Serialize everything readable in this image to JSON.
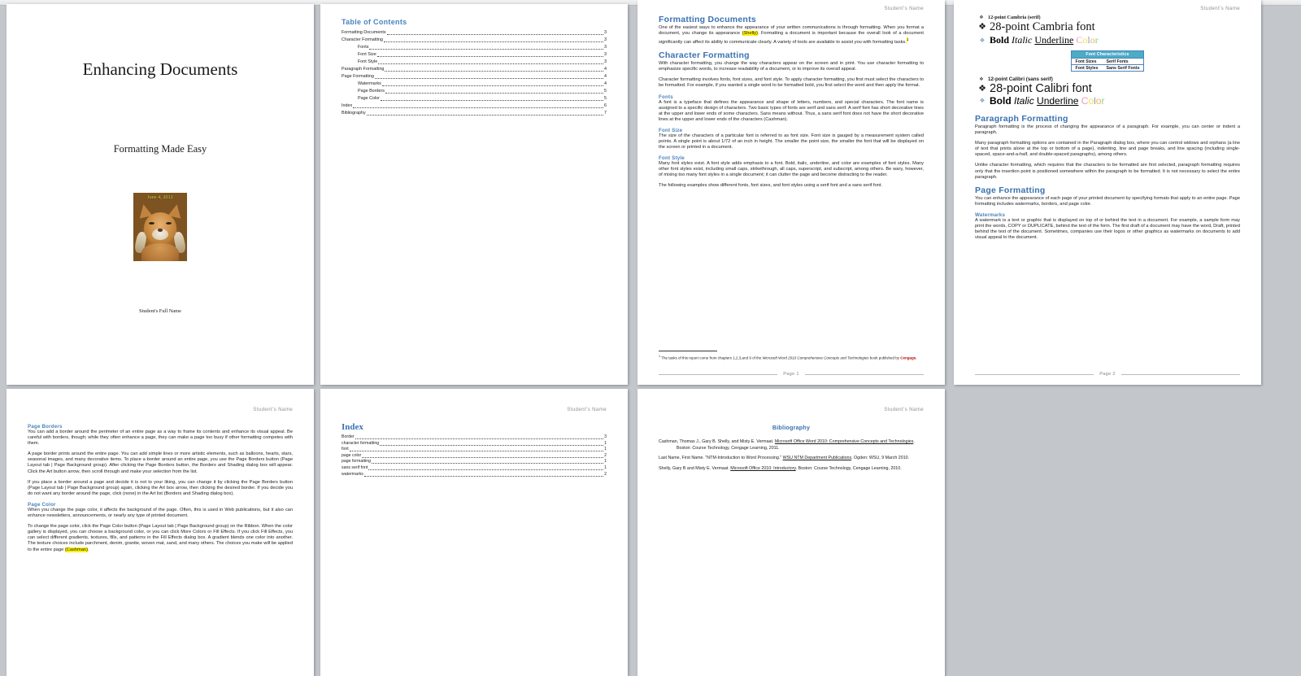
{
  "app": {
    "view": "multi-page-document-view",
    "background_color": "#c3c7cc",
    "header_name": "Student's Name"
  },
  "pages": [
    {
      "id": "title-page",
      "title": "Enhancing Documents",
      "subtitle": "Formatting Made Easy",
      "image_caption": "June 4, 2012",
      "image_alt": "lynx-photo",
      "author": "Student's Full Name"
    },
    {
      "id": "table-of-contents",
      "heading": "Table of Contents",
      "entries": [
        {
          "label": "Formatting Documents",
          "page": "3",
          "level": 1
        },
        {
          "label": "Character Formatting",
          "page": "3",
          "level": 1
        },
        {
          "label": "Fonts",
          "page": "3",
          "level": 2
        },
        {
          "label": "Font Size",
          "page": "3",
          "level": 2
        },
        {
          "label": "Font Style",
          "page": "3",
          "level": 2
        },
        {
          "label": "Paragraph Formatting",
          "page": "4",
          "level": 1
        },
        {
          "label": "Page Formatting",
          "page": "4",
          "level": 1
        },
        {
          "label": "Watermarks",
          "page": "4",
          "level": 2
        },
        {
          "label": "Page Borders",
          "page": "5",
          "level": 2
        },
        {
          "label": "Page Color",
          "page": "5",
          "level": 2
        },
        {
          "label": "Index",
          "page": "6",
          "level": 1
        },
        {
          "label": "Bibliography",
          "page": "7",
          "level": 1
        }
      ]
    },
    {
      "id": "page-1-content",
      "header": "Student's Name",
      "footer": "Page 1",
      "h1_formatting_documents": "Formatting Documents",
      "p_formatting_1a": "One of the easiest ways to enhance the appearance of your written communications is through formatting. When you format a document, you change its appearance ",
      "p_formatting_highlight": "(Shelly)",
      "p_formatting_1b": ". Formatting a document is important because the overall look of a document significantly can affect its ability to communicate clearly. A variety of tools are available to assist you with formatting tasks.",
      "h1_character_formatting": "Character Formatting",
      "p_character_1": "With character formatting, you change the way characters appear on the screen and in print. You use character formatting to emphasize specific words, to increase readability of a document, or to improve its overall appeal.",
      "p_character_2": "Character formatting involves fonts, font sizes, and font style. To apply character formatting, you first must select the characters to be formatted. For example, if you wanted a single word to be formatted bold, you first select the word and then apply the format.",
      "h2_fonts": "Fonts",
      "p_fonts": "A font is a typeface that defines the appearance and shape of letters, numbers, and special characters. The font name is assigned to a specific design of characters. Two basic types of fonts are serif and sans serif. A serif font has short decorative lines at the upper and lower ends of some characters. Sans means without. Thus, a sans serif font does not have the short decorative lines at the upper and lower ends of the characters (Cashman).",
      "h2_font_size": "Font Size",
      "p_font_size": "The size of the characters of a particular font is referred to as font size. Font size is gauged by a measurement system called points. A single point is about 1/72 of an inch in height. The smaller the point size, the smaller the font that will be displayed on the screen or printed in a document.",
      "h2_font_style": "Font Style",
      "p_font_style": "Many font styles exist. A font style adds emphasis to a font. Bold, italic, underline, and color are examples of font styles. Many other font styles exist, including small caps, strikethrough, all caps, superscript, and subscript, among others. Be wary, however, of mixing too many font styles in a single document; it can clutter the page and become distracting to the reader.",
      "p_examples": "The following examples show different fonts, font sizes, and font styles using a serif font and a sans serif font.",
      "footnote_marker": "1",
      "footnote_a": "The tasks of this report come from chapters 1,2,3,and 9 of the ",
      "footnote_italic": "Microsoft Word 2010 Comprehensive Concepts and Technologies",
      "footnote_b": " book published by ",
      "footnote_publisher": "Cengage."
    },
    {
      "id": "page-2-content",
      "header": "Student's Name",
      "footer": "Page 2",
      "samples": [
        {
          "label": "12-point Cambria (serif)",
          "style": "small-serif"
        },
        {
          "label": "28-point Cambria font",
          "style": "big-serif"
        },
        {
          "label": "Bold Italic Underline Color",
          "style": "styles-serif"
        },
        {
          "label": "12-point Calibri (sans serif)",
          "style": "small-sans"
        },
        {
          "label": "28-point Calibri font",
          "style": "big-sans"
        },
        {
          "label": "Bold Italic Underline Color",
          "style": "styles-sans"
        }
      ],
      "style_words": {
        "bold": "Bold",
        "italic": "Italic",
        "underline": "Underline",
        "color": "Color"
      },
      "color_letters": [
        "C",
        "o",
        "l",
        "o",
        "r"
      ],
      "font_table": {
        "caption": "Font Characteristics",
        "rows": [
          [
            "Font Sizes",
            "Serif Fonts"
          ],
          [
            "Font Styles",
            "Sans Serif Fonts"
          ]
        ]
      },
      "h1_paragraph_formatting": "Paragraph Formatting",
      "p_paragraph_1": "Paragraph formatting is the process of changing the appearance of a paragraph. For example, you can center or indent a paragraph.",
      "p_paragraph_2": "Many paragraph formatting options are contained in the Paragraph dialog box, where you can control widows and orphans (a line of text that prints alone at the top or bottom of a page), indenting, line and page breaks, and line spacing (including single-spaced, space-and-a-half, and double-spaced paragraphs), among others.",
      "p_paragraph_3": "Unlike character formatting, which requires that the characters to be formatted are first selected, paragraph formatting requires only that the insertion point is positioned somewhere within the paragraph to be formatted. It is not necessary to select the entire paragraph.",
      "h1_page_formatting": "Page Formatting",
      "p_page_formatting": "You can enhance the appearance of each page of your printed document by specifying formats that apply to an entire page. Page formatting includes watermarks, borders, and page color.",
      "h2_watermarks": "Watermarks",
      "p_watermarks": "A watermark is a text or graphic that is displayed on top of or behind the text in a document. For example, a sample form may print the words, COPY or DUPLICATE, behind the text of the form. The first draft of a document may have the word, Draft, printed behind the text of the document. Sometimes, companies use their logos or other graphics as watermarks on documents to add visual appeal to the document."
    },
    {
      "id": "page-3-content",
      "header": "Student's Name",
      "h2_page_borders": "Page Borders",
      "p_borders_1": "You can add a border around the perimeter of an entire page as a way to frame its contents and enhance its visual appeal. Be careful with borders, though; while they often enhance a page, they can make a page too busy if other formatting competes with them.",
      "p_borders_2": "A page border prints around the entire page. You can add simple lines or more artistic elements, such as balloons, hearts, stars, seasonal images, and many decorative items. To place a border around an entire page, you use the Page Borders button (Page Layout tab | Page Background group). After clicking the Page Borders button, the Borders and Shading dialog box will appear. Click the Art button arrow, then scroll through and make your selection from the list.",
      "p_borders_3": "If you place a border around a page and decide it is not to your liking, you can change it by clicking the Page Borders button (Page Layout tab | Page Background group) again, clicking the Art box arrow, then clicking the desired border. If you decide you do not want any border around the page, click (none) in the Art list (Borders and Shading dialog box).",
      "h2_page_color": "Page Color",
      "p_color_1": "When you change the page color, it affects the background of the page. Often, this is used in Web publications, but it also can enhance newsletters, announcements, or nearly any type of printed document.",
      "p_color_2a": "To change the page color, click the Page Color button (Page Layout tab | Page Background group) on the Ribbon. When the color gallery is displayed, you can choose a background color, or you can click More Colors or Fill Effects. If you click Fill Effects, you can select different gradients, textures, fills, and patterns in the Fill Effects dialog box. A gradient blends one color into another. The texture choices include parchment, denim, granite, woven mat, sand, and many others. The choices you make will be applied to the entire page ",
      "p_color_highlight": "(Cashman)",
      "p_color_2b": "."
    },
    {
      "id": "index-page",
      "header": "Student's Name",
      "heading": "Index",
      "entries": [
        {
          "label": "Border",
          "page": "3"
        },
        {
          "label": "character formatting",
          "page": "1"
        },
        {
          "label": "font",
          "page": "1"
        },
        {
          "label": "page color",
          "page": "2"
        },
        {
          "label": "page formatting",
          "page": "1"
        },
        {
          "label": "sans serif font",
          "page": "1"
        },
        {
          "label": "watermarks",
          "page": "2"
        }
      ]
    },
    {
      "id": "bibliography-page",
      "header": "Student's Name",
      "heading": "Bibliography",
      "entries": [
        {
          "author": "Cashman, Thomas J., Gary B. Shelly, and Misty E. Vermaat. ",
          "title": "Microsoft Office Word 2010: Comprehensive Concepts and Technologies",
          "rest": ". Boston: Course Technology, Cengage Learning, 2011."
        },
        {
          "author": "Last Name, First Name. \"NTM-Introduction to Word Processing.\" ",
          "title": "WSU NTM Department Publications",
          "rest": ". Ogden: WSU, 9 March 2010."
        },
        {
          "author": "Shelly, Gary B and Misty E. Vermaat. ",
          "title": "Microsoft Office 2010: Introductory",
          "rest": ". Boston: Course Technology, Cengage Learning, 2010."
        }
      ]
    }
  ]
}
